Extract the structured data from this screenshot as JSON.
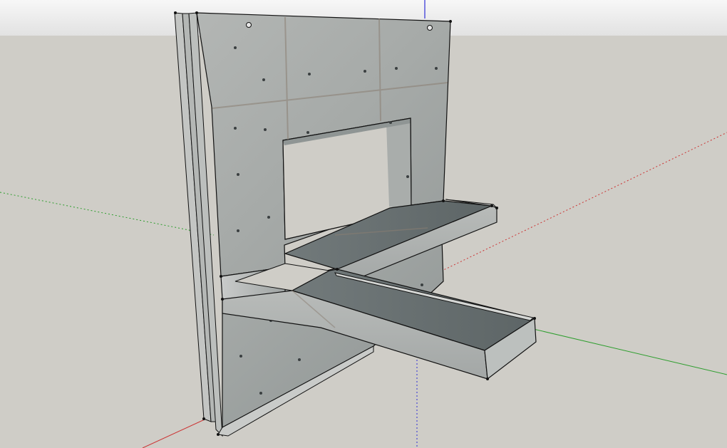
{
  "viewport": {
    "sky_color": "#f1f1f1",
    "ground_color": "#cfcdc7",
    "axis_red_color": "#cc3333",
    "axis_green_color": "#2e9e2e",
    "axis_blue_color": "#2d2dd6",
    "concrete_light": "#aeb1af",
    "concrete_mid": "#9ea3a3",
    "concrete_dark": "#6f7676",
    "edge_color": "#111111"
  },
  "model": {
    "objects": [
      "concrete-wall-panel",
      "window-opening",
      "upper-shelf-slab",
      "lower-shelf-slab"
    ]
  }
}
